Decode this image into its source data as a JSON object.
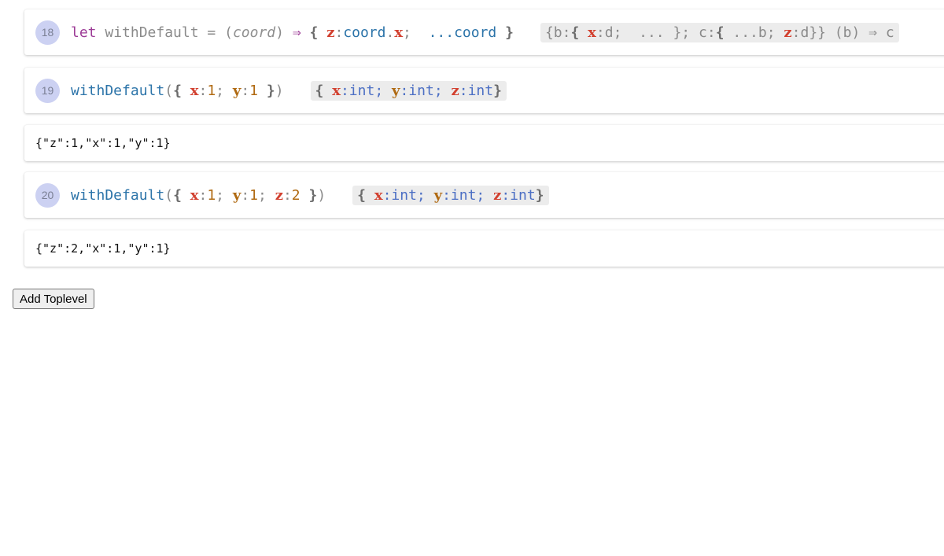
{
  "cells": [
    {
      "number": "18",
      "code": {
        "kw": "let",
        "name": "withDefault",
        "eq": "=",
        "param_open": "(",
        "param": "coord",
        "param_close": ")",
        "arrow": "⇒",
        "brace_open": "{",
        "attr_z": "z",
        "colon1": ":",
        "coord_ref": "coord",
        "dot": ".",
        "attr_x": "x",
        "semi": ";",
        "spread": "...coord",
        "brace_close": "}"
      },
      "type": {
        "open": "{b:",
        "inner_open": "{",
        "attr_x": "x",
        "colon_d": ":d;",
        "ellipsis": "...",
        "inner_close": "};",
        "c_label": "c:",
        "c_open": "{",
        "spread_b": "...b;",
        "attr_z": "z",
        "colon_d2": ":d",
        "close": "}} (b) ⇒ c"
      }
    },
    {
      "number": "19",
      "code": {
        "fn": "withDefault",
        "open": "(",
        "brace_open": "{",
        "attr_x": "x",
        "colon1": ":",
        "val_x": "1",
        "semi1": ";",
        "attr_y": "y",
        "colon2": ":",
        "val_y": "1",
        "brace_close": "}",
        "close": ")"
      },
      "type": {
        "brace_open": "{",
        "attr_x": "x",
        "t_x": ":int;",
        "attr_y": "y",
        "t_y": ":int;",
        "attr_z": "z",
        "t_z": ":int",
        "brace_close": "}"
      },
      "output": "{\"z\":1,\"x\":1,\"y\":1}"
    },
    {
      "number": "20",
      "code": {
        "fn": "withDefault",
        "open": "(",
        "brace_open": "{",
        "attr_x": "x",
        "colon1": ":",
        "val_x": "1",
        "semi1": ";",
        "attr_y": "y",
        "colon2": ":",
        "val_y": "1",
        "semi2": ";",
        "attr_z": "z",
        "colon3": ":",
        "val_z": "2",
        "brace_close": "}",
        "close": ")"
      },
      "type": {
        "brace_open": "{",
        "attr_x": "x",
        "t_x": ":int;",
        "attr_y": "y",
        "t_y": ":int;",
        "attr_z": "z",
        "t_z": ":int",
        "brace_close": "}"
      },
      "output": "{\"z\":2,\"x\":1,\"y\":1}"
    }
  ],
  "add_button_label": "Add Toplevel"
}
